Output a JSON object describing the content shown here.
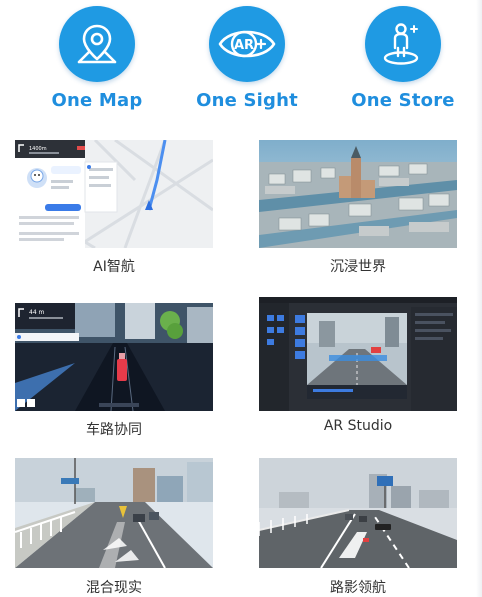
{
  "features": [
    {
      "label": "One Map",
      "icon": "map-pin-icon"
    },
    {
      "label": "One Sight",
      "icon": "ar-eye-icon",
      "icon_text": "AR"
    },
    {
      "label": "One Store",
      "icon": "person-location-icon"
    }
  ],
  "tiles": [
    {
      "caption": "AI智航",
      "thumb_text": "1400m"
    },
    {
      "caption": "沉浸世界"
    },
    {
      "caption": "车路协同",
      "thumb_text": "44 m"
    },
    {
      "caption": "AR Studio"
    },
    {
      "caption": "混合现实"
    },
    {
      "caption": "路影领航"
    }
  ],
  "colors": {
    "accent": "#1f9ae3",
    "label": "#1f8ede",
    "caption": "#333333"
  }
}
